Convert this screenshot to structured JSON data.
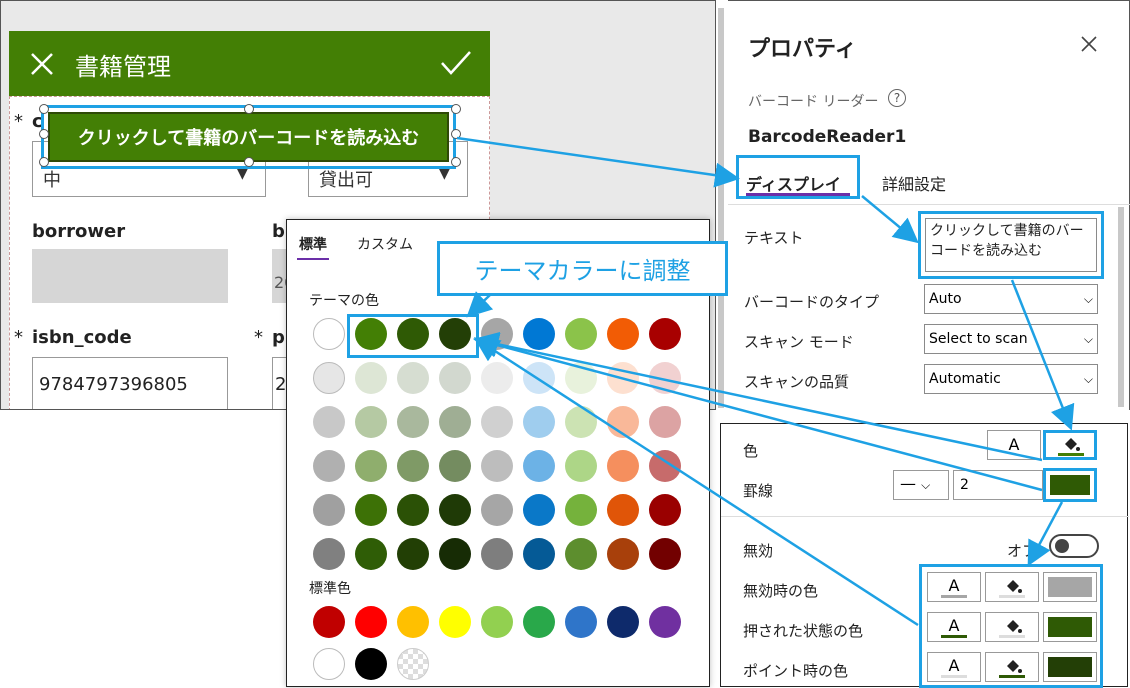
{
  "canvas": {
    "form_title": "書籍管理",
    "scan_button_text": "クリックして書籍のバーコードを読み込む",
    "field_partial_1": "c",
    "field_value_1": "中",
    "field_value_2": "貸出可",
    "borrower_label": "borrower",
    "b_label_partial": "b",
    "b_value_partial": "20",
    "isbn_label": "isbn_code",
    "isbn_value": "9784797396805",
    "p_label_partial": "p",
    "p_value_partial": "2"
  },
  "properties": {
    "title": "プロパティ",
    "control_type": "バーコード リーダー",
    "control_name": "BarcodeReader1",
    "tab_display": "ディスプレイ",
    "tab_advanced": "詳細設定",
    "text_label": "テキスト",
    "text_value": "クリックして書籍のバーコードを読み込む",
    "barcode_type_label": "バーコードのタイプ",
    "barcode_type_value": "Auto",
    "scan_mode_label": "スキャン モード",
    "scan_mode_value": "Select to scan",
    "scan_quality_label": "スキャンの品質",
    "scan_quality_value": "Automatic"
  },
  "palette": {
    "tab_standard": "標準",
    "tab_custom": "カスタム",
    "theme_colors_label": "テーマの色",
    "standard_colors_label": "標準色",
    "theme_rows": [
      [
        "#ffffff",
        "#437f05",
        "#2f5a05",
        "#233f06",
        "#a6a6a6",
        "#0078d4",
        "#8bc34a",
        "#f25c05",
        "#a80000"
      ],
      [
        "#e6e6e6",
        "#dde6d5",
        "#d6ddd1",
        "#d2d8cf",
        "#ececec",
        "#cde4f7",
        "#e8f2dc",
        "#fde0d0",
        "#f1d1d1"
      ],
      [
        "#c8c8c8",
        "#b5c9a3",
        "#a9b89d",
        "#9fae94",
        "#d0d0d0",
        "#9fcdee",
        "#cce3b3",
        "#f9b899",
        "#dca3a3"
      ],
      [
        "#b0b0b0",
        "#8fae6d",
        "#7f9a66",
        "#748c60",
        "#bdbdbd",
        "#6cb2e6",
        "#add687",
        "#f58f5e",
        "#c76b6b"
      ],
      [
        "#a0a0a0",
        "#3d7106",
        "#2b5106",
        "#1f3a06",
        "#a6a6a6",
        "#0a78c8",
        "#75b23c",
        "#e05508",
        "#9a0000"
      ],
      [
        "#808080",
        "#2f5d06",
        "#223f05",
        "#172c05",
        "#7e7e7e",
        "#055a96",
        "#5d8e2e",
        "#a8400b",
        "#720000"
      ]
    ],
    "standard_rows": [
      [
        "#c00000",
        "#ff0000",
        "#ffc000",
        "#ffff00",
        "#92d050",
        "#29a84a",
        "#2f75c9",
        "#0e2a6b",
        "#7030a0"
      ],
      [
        "#ffffff",
        "#000000",
        "transparent"
      ]
    ]
  },
  "callout": {
    "text": "テーマカラーに調整"
  },
  "properties_lower": {
    "color_label": "色",
    "color_text_glyph": "A",
    "border_label": "罫線",
    "border_style_glyph": "—",
    "border_width_value": "2",
    "disabled_label": "無効",
    "disabled_state": "オフ",
    "disabled_color_label": "無効時の色",
    "pressed_color_label": "押された状態の色",
    "hover_color_label": "ポイント時の色",
    "glyph_a": "A",
    "fill_main": "#2f5a05",
    "fill_disabled": "#a6a6a6"
  }
}
